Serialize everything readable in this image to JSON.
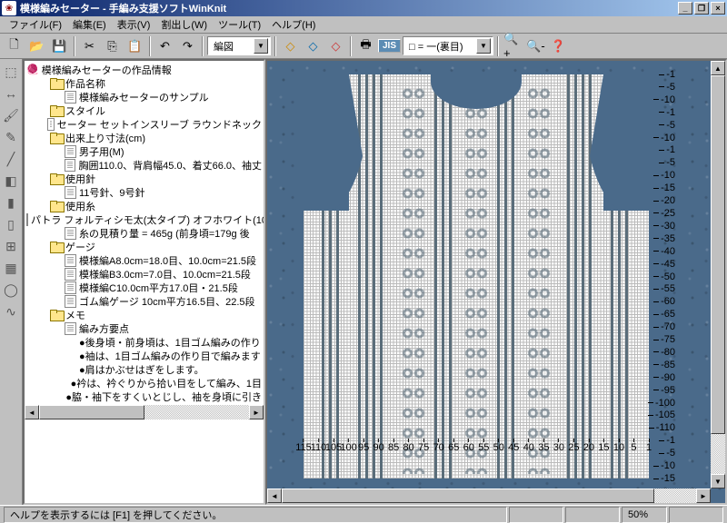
{
  "window": {
    "title": "模様編みセーター - 手編み支援ソフトWinKnit"
  },
  "menus": [
    "ファイル(F)",
    "編集(E)",
    "表示(V)",
    "割出し(W)",
    "ツール(T)",
    "ヘルプ(H)"
  ],
  "toolbar": {
    "combo1": "編図",
    "jis_label": "JIS",
    "combo2": "□ = 一(裏目)"
  },
  "tree": {
    "root": "模様編みセーターの作品情報",
    "nodes": [
      {
        "type": "folder",
        "depth": 1,
        "label": "作品名称"
      },
      {
        "type": "doc",
        "depth": 2,
        "label": "模様編みセーターのサンプル"
      },
      {
        "type": "folder",
        "depth": 1,
        "label": "スタイル"
      },
      {
        "type": "doc",
        "depth": 2,
        "label": "セーター セットインスリーブ ラウンドネック"
      },
      {
        "type": "folder",
        "depth": 1,
        "label": "出来上り寸法(cm)"
      },
      {
        "type": "doc",
        "depth": 2,
        "label": "男子用(M)"
      },
      {
        "type": "doc",
        "depth": 2,
        "label": "胸囲110.0、背肩幅45.0、着丈66.0、袖丈"
      },
      {
        "type": "folder",
        "depth": 1,
        "label": "使用針"
      },
      {
        "type": "doc",
        "depth": 2,
        "label": "11号針、9号針"
      },
      {
        "type": "folder",
        "depth": 1,
        "label": "使用糸"
      },
      {
        "type": "doc",
        "depth": 2,
        "label": "パトラ フォルティシモ太(太タイプ) オフホワイト(10"
      },
      {
        "type": "doc",
        "depth": 2,
        "label": "糸の見積り量 = 465g (前身頃=179g 後"
      },
      {
        "type": "folder",
        "depth": 1,
        "label": "ゲージ"
      },
      {
        "type": "doc",
        "depth": 2,
        "label": "模様編A8.0cm=18.0目、10.0cm=21.5段"
      },
      {
        "type": "doc",
        "depth": 2,
        "label": "模様編B3.0cm=7.0目、10.0cm=21.5段"
      },
      {
        "type": "doc",
        "depth": 2,
        "label": "模様編C10.0cm平方17.0目・21.5段"
      },
      {
        "type": "doc",
        "depth": 2,
        "label": "ゴム編ゲージ 10cm平方16.5目、22.5段"
      },
      {
        "type": "folder",
        "depth": 1,
        "label": "メモ"
      },
      {
        "type": "doc",
        "depth": 2,
        "label": "編み方要点"
      },
      {
        "type": "bullet",
        "depth": 3,
        "label": "●後身頃・前身頃は、1目ゴム編みの作り"
      },
      {
        "type": "bullet",
        "depth": 3,
        "label": "●袖は、1目ゴム編みの作り目で編みます"
      },
      {
        "type": "bullet",
        "depth": 3,
        "label": "●肩はかぶせはぎをします。"
      },
      {
        "type": "bullet",
        "depth": 3,
        "label": "●衿は、衿ぐりから拾い目をして編み、1目"
      },
      {
        "type": "bullet",
        "depth": 3,
        "label": "●脇・袖下をすくいとじし、袖を身頃に引き"
      }
    ]
  },
  "ruler_v": [
    "-1",
    "-5",
    "-10",
    "-1",
    "-5",
    "-10",
    "-1",
    "-5",
    "-10",
    "-15",
    "-20",
    "-25",
    "-30",
    "-35",
    "-40",
    "-45",
    "-50",
    "-55",
    "-60",
    "-65",
    "-70",
    "-75",
    "-80",
    "-85",
    "-90",
    "-95",
    "-100",
    "-105",
    "-110",
    "-1",
    "-5",
    "-10",
    "-15"
  ],
  "ruler_h": [
    "115",
    "110",
    "105",
    "100",
    "95",
    "90",
    "85",
    "80",
    "75",
    "70",
    "65",
    "60",
    "55",
    "50",
    "45",
    "40",
    "35",
    "30",
    "25",
    "20",
    "15",
    "10",
    "5",
    "1"
  ],
  "status": {
    "help": "ヘルプを表示するには [F1] を押してください。",
    "zoom": "50%"
  }
}
